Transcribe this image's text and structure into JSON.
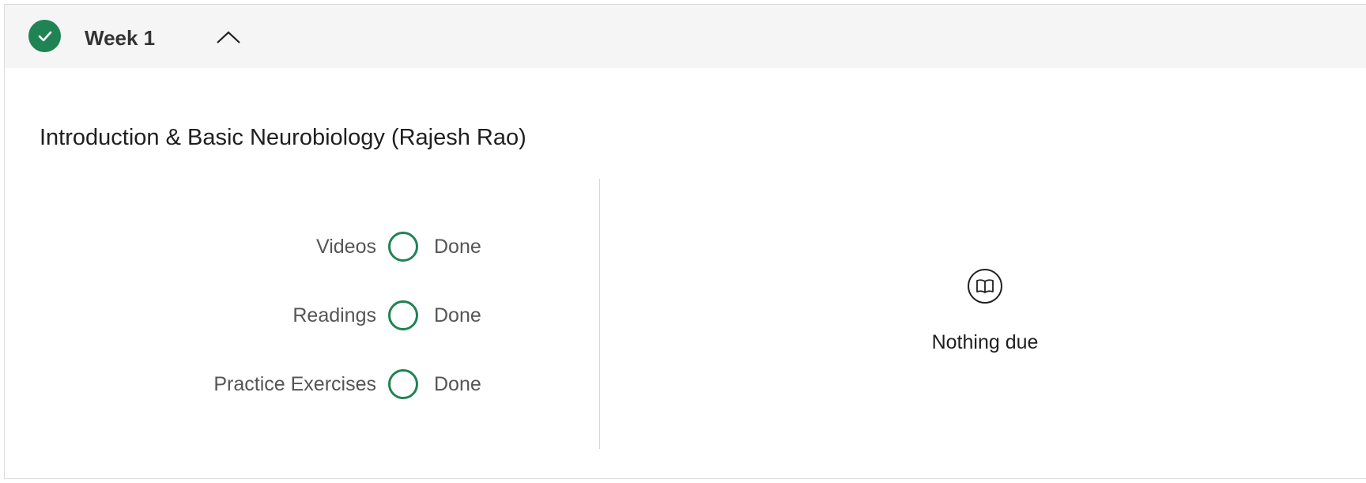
{
  "week": {
    "title": "Week 1",
    "status_icon": "check-circle-icon",
    "toggle_icon": "chevron-up-icon",
    "accent_color": "#1f8354"
  },
  "section": {
    "title": "Introduction & Basic Neurobiology (Rajesh Rao)"
  },
  "progress": [
    {
      "label": "Videos",
      "status": "Done",
      "icon": "ring-icon"
    },
    {
      "label": "Readings",
      "status": "Done",
      "icon": "ring-icon"
    },
    {
      "label": "Practice Exercises",
      "status": "Done",
      "icon": "ring-icon"
    }
  ],
  "due": {
    "icon": "book-icon",
    "text": "Nothing due"
  }
}
